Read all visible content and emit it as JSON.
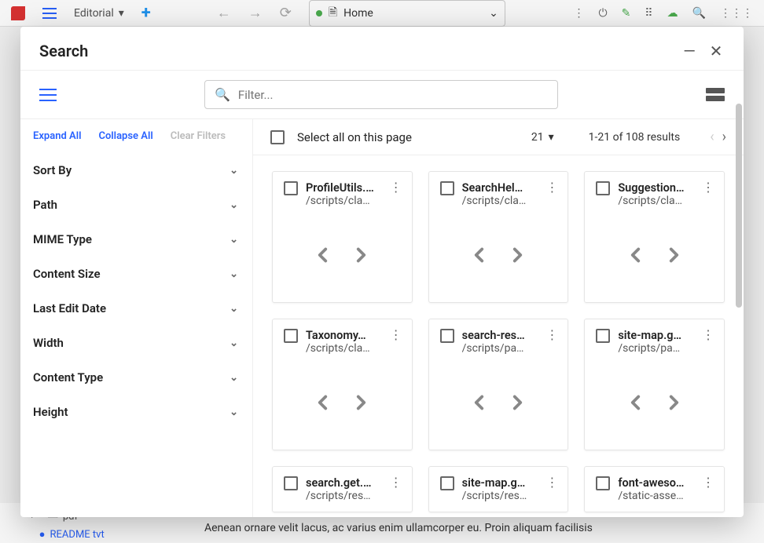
{
  "bg": {
    "editorial": "Editorial",
    "home": "Home"
  },
  "dialog": {
    "title": "Search",
    "filter_placeholder": "Filter...",
    "actions": {
      "expand": "Expand All",
      "collapse": "Collapse All",
      "clear": "Clear Filters"
    },
    "filters": [
      "Sort By",
      "Path",
      "MIME Type",
      "Content Size",
      "Last Edit Date",
      "Width",
      "Content Type",
      "Height"
    ],
    "select_all": "Select all on this page",
    "page_size": "21",
    "count_label": "1-21 of 108 results"
  },
  "cards": [
    {
      "name": "ProfileUtils.…",
      "path": "/scripts/cla…"
    },
    {
      "name": "SearchHel…",
      "path": "/scripts/cla…"
    },
    {
      "name": "Suggestion…",
      "path": "/scripts/cla…"
    },
    {
      "name": "Taxonomy…",
      "path": "/scripts/cla…"
    },
    {
      "name": "search-res…",
      "path": "/scripts/pa…"
    },
    {
      "name": "site-map.g…",
      "path": "/scripts/pa…"
    },
    {
      "name": "search.get.…",
      "path": "/scripts/res…"
    },
    {
      "name": "site-map.g…",
      "path": "/scripts/res…"
    },
    {
      "name": "font-aweso…",
      "path": "/static-asse…"
    }
  ],
  "bg_bottom": {
    "pdf": "pdf",
    "readme": "README tvt",
    "lorem": "Aenean ornare velit lacus, ac varius enim ullamcorper eu. Proin aliquam facilisis"
  }
}
